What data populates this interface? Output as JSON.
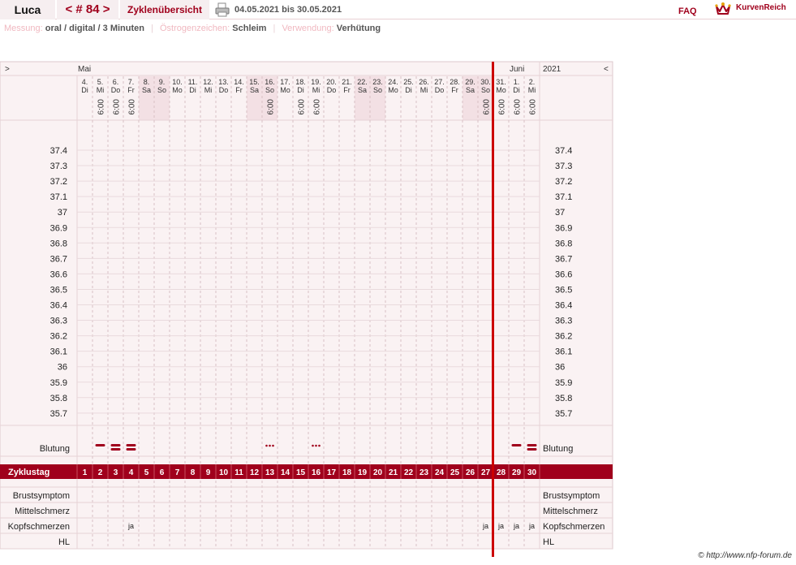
{
  "header": {
    "user_name": "Luca",
    "cycle_label": "< # 84 >",
    "overview_label": "Zyklenübersicht",
    "printer_icon": "printer-icon",
    "date_range": "04.05.2021 bis 30.05.2021",
    "faq_label": "FAQ",
    "logo_text": "KurvenReich",
    "logo_icon": "crown-icon"
  },
  "info": {
    "measurement_label": "Messung:",
    "measurement_value": "oral / digital / 3 Minuten",
    "estrogen_label": "Östrogenzeichen:",
    "estrogen_value": "Schleim",
    "usage_label": "Verwendung:",
    "usage_value": "Verhütung"
  },
  "nav": {
    "prev": ">",
    "next": "<"
  },
  "months": {
    "first": "Mai",
    "second": "Juni",
    "year": "2021"
  },
  "colors": {
    "accent": "#a0001c",
    "grid_bg": "#faf2f3",
    "weekend_bg": "#f3e0e4",
    "row_line": "#e6d2d6"
  },
  "days": [
    {
      "date": "4.",
      "weekday": "Di",
      "time": ""
    },
    {
      "date": "5.",
      "weekday": "Mi",
      "time": "6:00"
    },
    {
      "date": "6.",
      "weekday": "Do",
      "time": "6:00"
    },
    {
      "date": "7.",
      "weekday": "Fr",
      "time": "6:00"
    },
    {
      "date": "8.",
      "weekday": "Sa",
      "time": ""
    },
    {
      "date": "9.",
      "weekday": "So",
      "time": ""
    },
    {
      "date": "10.",
      "weekday": "Mo",
      "time": ""
    },
    {
      "date": "11.",
      "weekday": "Di",
      "time": ""
    },
    {
      "date": "12.",
      "weekday": "Mi",
      "time": ""
    },
    {
      "date": "13.",
      "weekday": "Do",
      "time": ""
    },
    {
      "date": "14.",
      "weekday": "Fr",
      "time": ""
    },
    {
      "date": "15.",
      "weekday": "Sa",
      "time": ""
    },
    {
      "date": "16.",
      "weekday": "So",
      "time": "6:00"
    },
    {
      "date": "17.",
      "weekday": "Mo",
      "time": ""
    },
    {
      "date": "18.",
      "weekday": "Di",
      "time": "6:00"
    },
    {
      "date": "19.",
      "weekday": "Mi",
      "time": "6:00"
    },
    {
      "date": "20.",
      "weekday": "Do",
      "time": ""
    },
    {
      "date": "21.",
      "weekday": "Fr",
      "time": ""
    },
    {
      "date": "22.",
      "weekday": "Sa",
      "time": ""
    },
    {
      "date": "23.",
      "weekday": "So",
      "time": ""
    },
    {
      "date": "24.",
      "weekday": "Mo",
      "time": ""
    },
    {
      "date": "25.",
      "weekday": "Di",
      "time": ""
    },
    {
      "date": "26.",
      "weekday": "Mi",
      "time": ""
    },
    {
      "date": "27.",
      "weekday": "Do",
      "time": ""
    },
    {
      "date": "28.",
      "weekday": "Fr",
      "time": ""
    },
    {
      "date": "29.",
      "weekday": "Sa",
      "time": ""
    },
    {
      "date": "30.",
      "weekday": "So",
      "time": "6:00"
    },
    {
      "date": "31.",
      "weekday": "Mo",
      "time": "6:00"
    },
    {
      "date": "1.",
      "weekday": "Di",
      "time": "6:00"
    },
    {
      "date": "2.",
      "weekday": "Mi",
      "time": "6:00"
    }
  ],
  "weekend_days": [
    5,
    6,
    12,
    13,
    19,
    20,
    26,
    27
  ],
  "cycle_split_after_day": 27,
  "temperature_ticks": [
    "37.4",
    "37.3",
    "37.2",
    "37.1",
    "37",
    "36.9",
    "36.8",
    "36.7",
    "36.6",
    "36.5",
    "36.4",
    "36.3",
    "36.2",
    "36.1",
    "36",
    "35.9",
    "35.8",
    "35.7"
  ],
  "bleeding": {
    "label": "Blutung",
    "entries": [
      {
        "day": 2,
        "type": "dash"
      },
      {
        "day": 3,
        "type": "double"
      },
      {
        "day": 4,
        "type": "double"
      },
      {
        "day": 13,
        "type": "dots"
      },
      {
        "day": 16,
        "type": "dots"
      },
      {
        "day": 29,
        "type": "dash"
      },
      {
        "day": 30,
        "type": "double"
      }
    ]
  },
  "cycle_day_label": "Zyklustag",
  "cycle_days": [
    "1",
    "2",
    "3",
    "4",
    "5",
    "6",
    "7",
    "8",
    "9",
    "10",
    "11",
    "12",
    "13",
    "14",
    "15",
    "16",
    "17",
    "18",
    "19",
    "20",
    "21",
    "22",
    "23",
    "24",
    "25",
    "26",
    "27",
    "28",
    "29",
    "30"
  ],
  "symptom_rows": [
    {
      "label": "Brustsymptom",
      "values": {}
    },
    {
      "label": "Mittelschmerz",
      "values": {}
    },
    {
      "label": "Kopfschmerzen",
      "values": {
        "4": "ja",
        "27": "ja",
        "28": "ja",
        "29": "ja",
        "30": "ja"
      }
    },
    {
      "label": "HL",
      "values": {}
    }
  ],
  "footer": "© http://www.nfp-forum.de"
}
